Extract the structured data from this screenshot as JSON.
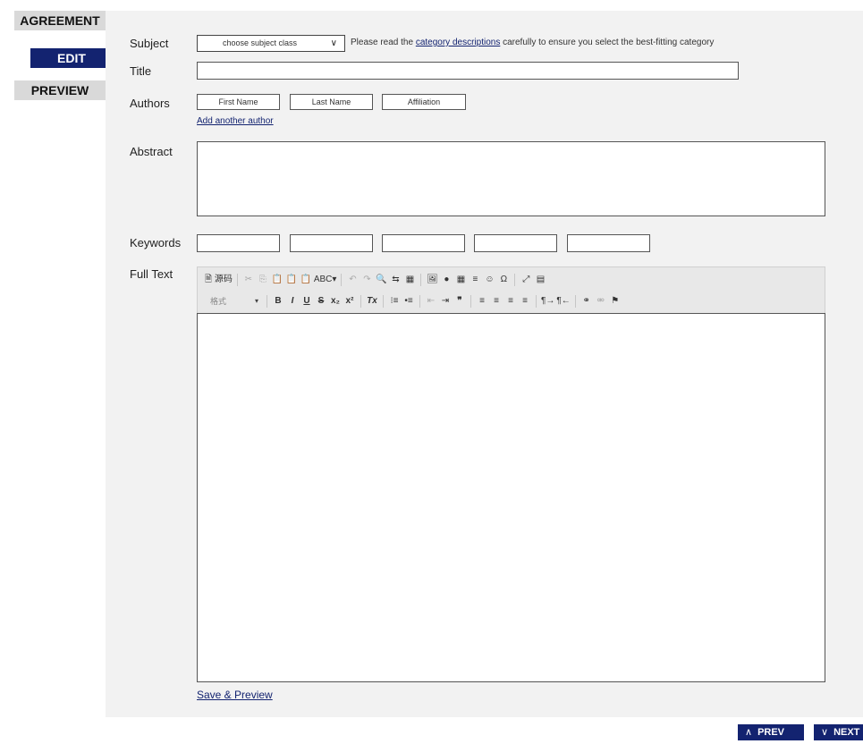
{
  "steps": {
    "agreement": "AGREEMENT",
    "edit": "EDIT",
    "preview": "PREVIEW"
  },
  "form": {
    "subject": {
      "label": "Subject",
      "select_value": "choose subject class",
      "note_before": "Please read the ",
      "note_link": "category descriptions",
      "note_after": " carefully to ensure you select the best-fitting category"
    },
    "title": {
      "label": "Title",
      "value": ""
    },
    "authors": {
      "label": "Authors",
      "first_name": "First Name",
      "last_name": "Last Name",
      "affiliation": "Affiliation",
      "add_link": "Add another author"
    },
    "abstract": {
      "label": "Abstract",
      "value": ""
    },
    "keywords": {
      "label": "Keywords",
      "values": [
        "",
        "",
        "",
        "",
        ""
      ]
    },
    "full_text": {
      "label": "Full Text",
      "toolbar_row1": [
        "🗎 源码",
        "✂",
        "⎘",
        "📋",
        "📋",
        "📋",
        "ABC▾",
        "↶",
        "↷",
        "🔍",
        "⇆",
        "▦",
        "🖼",
        "●",
        "▦",
        "≡",
        "☺",
        "Ω",
        "⤢",
        "▤"
      ],
      "format_label": "格式",
      "toolbar_row2": [
        "B",
        "I",
        "U",
        "S",
        "x₂",
        "x²",
        "Tx",
        "⁝≡",
        "•≡",
        "⇤",
        "⇥",
        "❞",
        "≡",
        "≡",
        "≡",
        "≡",
        "¶→",
        "¶←",
        "⚭",
        "⚮",
        "⚑"
      ]
    },
    "save_link": "Save & Preview"
  },
  "nav": {
    "prev": "PREV",
    "next": "NEXT",
    "prev_icon": "chevron-up-icon",
    "next_icon": "chevron-down-icon"
  },
  "colors": {
    "accent": "#132370",
    "panel_bg": "#f2f2f2",
    "step_bg": "#d9d9d9"
  }
}
